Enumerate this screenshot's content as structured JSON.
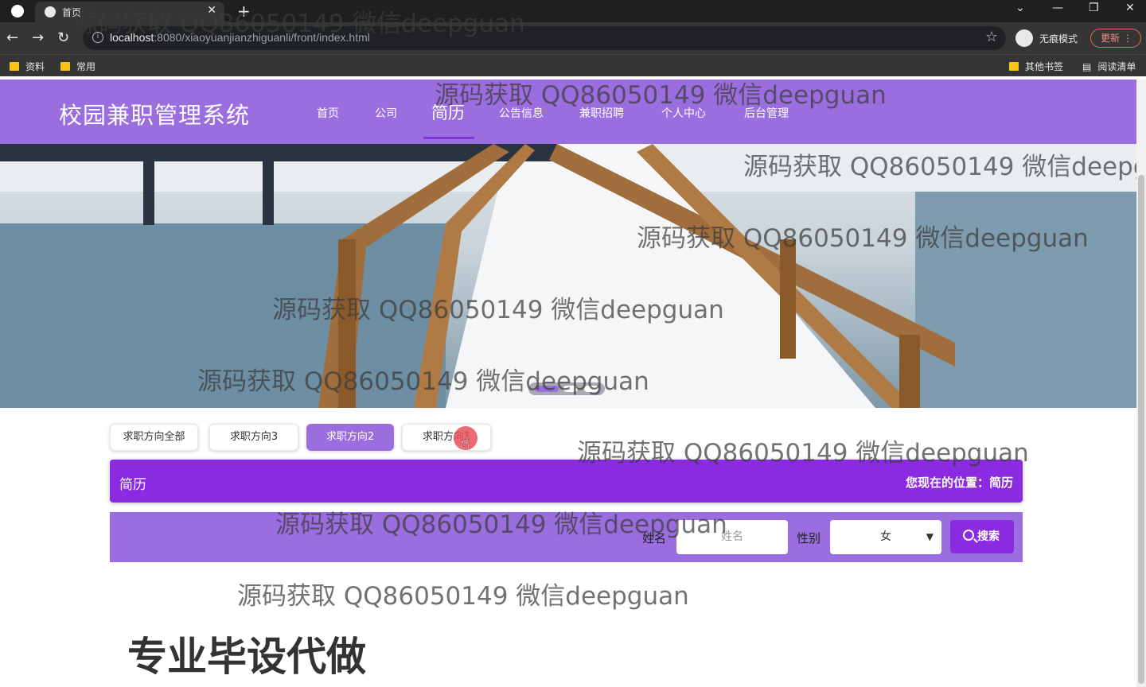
{
  "browser": {
    "tab_title": "首页",
    "url_host": "localhost",
    "url_rest": ":8080/xiaoyuanjianzhiguanli/front/index.html",
    "incognito_label": "无痕模式",
    "update_label": "更新",
    "bookmarks": [
      "资料",
      "常用"
    ],
    "bookmarks_right": [
      "其他书签",
      "阅读清单"
    ]
  },
  "site": {
    "title": "校园兼职管理系统",
    "nav": [
      "首页",
      "公司",
      "简历",
      "公告信息",
      "兼职招聘",
      "个人中心",
      "后台管理"
    ],
    "active_nav": "简历"
  },
  "filters": {
    "items": [
      "求职方向全部",
      "求职方向3",
      "求职方向2",
      "求职方向1"
    ],
    "active": "求职方向2"
  },
  "breadcrumb": {
    "title": "简历",
    "location": "您现在的位置：简历"
  },
  "search": {
    "name_label": "姓名",
    "name_placeholder": "姓名",
    "gender_label": "性别",
    "gender_value": "女",
    "button_label": "搜索"
  },
  "watermark": "源码获取 QQ86050149 微信deepguan",
  "promo_text": "专业毕设代做",
  "colors": {
    "header": "#9b6ee0",
    "accent": "#8a2be2"
  }
}
